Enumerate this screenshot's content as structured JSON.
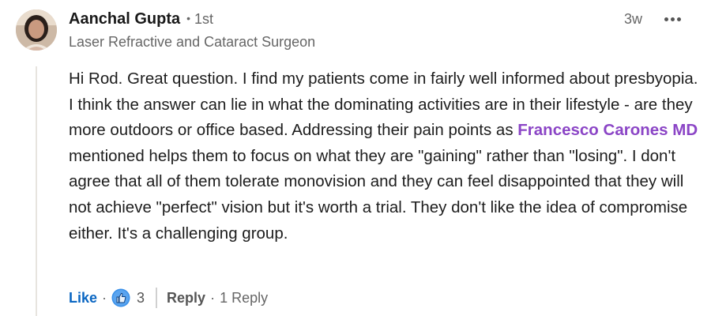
{
  "author": {
    "name": "Aanchal Gupta",
    "degree": "1st",
    "headline": "Laser Refractive and Cataract Surgeon",
    "avatar_icon": "profile-photo"
  },
  "meta": {
    "time": "3w",
    "more_icon": "ellipsis-horizontal-icon"
  },
  "comment": {
    "text_before_mention": "Hi Rod. Great question. I find my patients come in fairly well informed about presbyopia. I think the answer can lie in what the dominating activities are in their lifestyle - are they more outdoors or office based. Addressing their pain points as ",
    "mention": "Francesco Carones MD",
    "text_after_mention": " mentioned helps them to focus on what they are \"gaining\" rather than \"losing\". I don't agree that all of them tolerate monovision and they can feel disappointed that they will not achieve \"perfect\" vision but it's worth a trial. They don't like the idea of compromise either. It's a challenging group."
  },
  "actions": {
    "like_label": "Like",
    "separator": "·",
    "reaction_icon": "thumbs-up-reaction-icon",
    "reaction_count": "3",
    "reply_label": "Reply",
    "reply_count": "1 Reply"
  },
  "colors": {
    "link_blue": "#0a66c2",
    "mention_purple": "#8b45c6",
    "secondary_text": "#666666",
    "thread_line": "#e7e4df"
  }
}
